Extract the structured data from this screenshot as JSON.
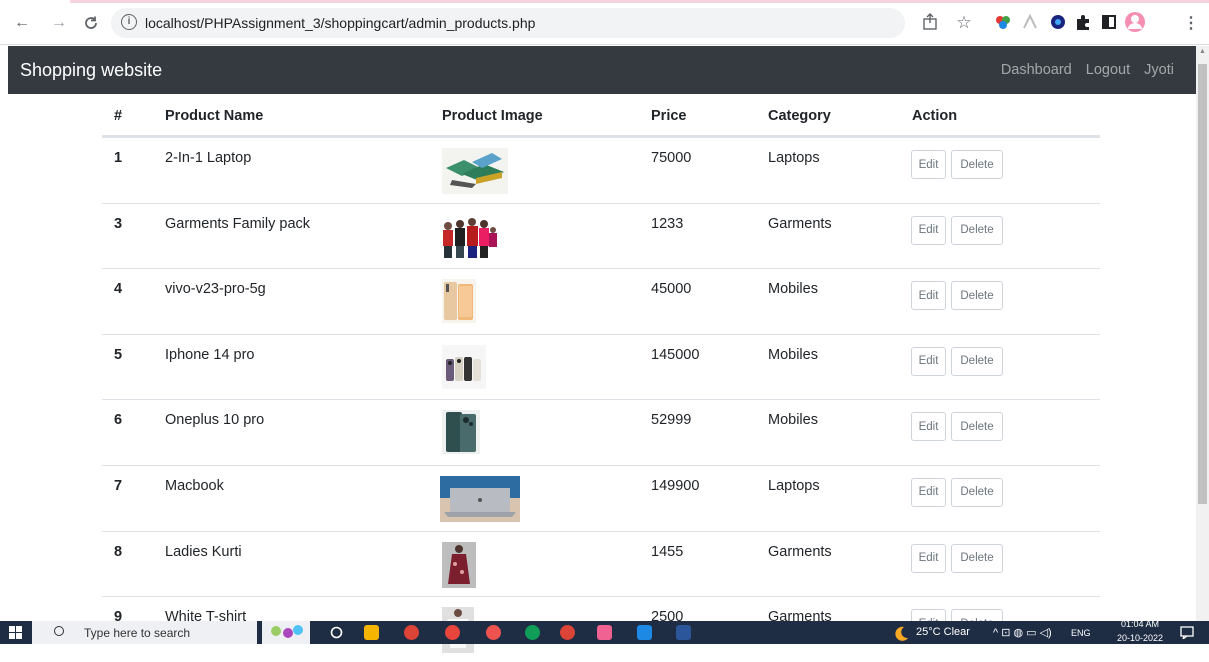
{
  "browser": {
    "url": "localhost/PHPAssignment_3/shoppingcart/admin_products.php",
    "info_glyph": "i"
  },
  "navbar": {
    "brand": "Shopping website",
    "links": [
      "Dashboard",
      "Logout",
      "Jyoti"
    ]
  },
  "table": {
    "headers": [
      "#",
      "Product Name",
      "Product Image",
      "Price",
      "Category",
      "Action"
    ],
    "edit_label": "Edit",
    "delete_label": "Delete",
    "rows": [
      {
        "id": "1",
        "name": "2-In-1 Laptop",
        "price": "75000",
        "category": "Laptops",
        "image": "laptop-2in1-image"
      },
      {
        "id": "3",
        "name": "Garments Family pack",
        "price": "1233",
        "category": "Garments",
        "image": "family-garments-image"
      },
      {
        "id": "4",
        "name": "vivo-v23-pro-5g",
        "price": "45000",
        "category": "Mobiles",
        "image": "vivo-phone-image"
      },
      {
        "id": "5",
        "name": "Iphone 14 pro",
        "price": "145000",
        "category": "Mobiles",
        "image": "iphone-image"
      },
      {
        "id": "6",
        "name": "Oneplus 10 pro",
        "price": "52999",
        "category": "Mobiles",
        "image": "oneplus-image"
      },
      {
        "id": "7",
        "name": "Macbook",
        "price": "149900",
        "category": "Laptops",
        "image": "macbook-image"
      },
      {
        "id": "8",
        "name": "Ladies Kurti",
        "price": "1455",
        "category": "Garments",
        "image": "kurti-image"
      },
      {
        "id": "9",
        "name": "White T-shirt",
        "price": "2500",
        "category": "Garments",
        "image": "tshirt-image"
      }
    ]
  },
  "taskbar": {
    "search_placeholder": "Type here to search",
    "weather": "25°C  Clear",
    "lang": "ENG",
    "time": "01:04 AM",
    "date": "20-10-2022"
  }
}
